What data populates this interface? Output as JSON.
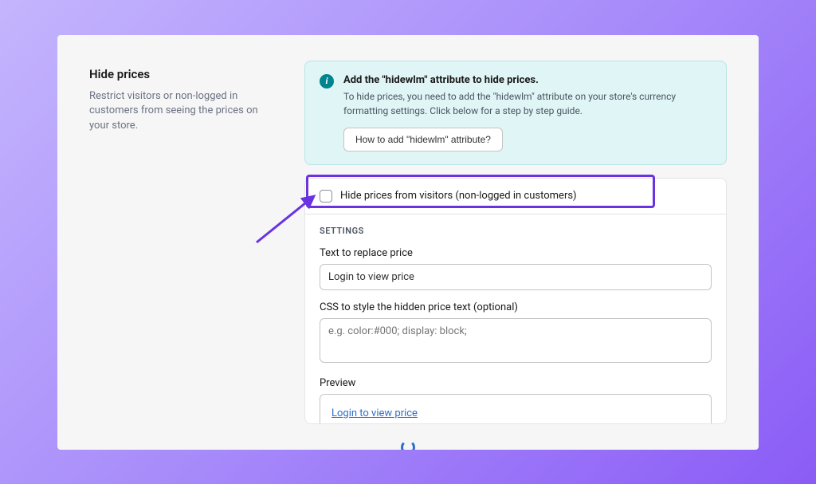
{
  "left": {
    "heading": "Hide prices",
    "desc": "Restrict visitors or non-logged in customers from seeing the prices on your store."
  },
  "banner": {
    "icon_glyph": "i",
    "title": "Add the \"hidewlm\" attribute to hide prices.",
    "text": "To hide prices, you need to add the \"hidewlm\" attribute on your store's currency formatting settings. Click below for a step by step guide.",
    "button": "How to add \"hidewlm\" attribute?"
  },
  "card": {
    "checkbox_label": "Hide prices from visitors (non-logged in customers)",
    "settings_header": "SETTINGS",
    "field_replace_label": "Text to replace price",
    "field_replace_value": "Login to view price",
    "field_css_label": "CSS to style the hidden price text (optional)",
    "field_css_placeholder": "e.g. color:#000; display: block;",
    "preview_label": "Preview",
    "preview_link": "Login to view price"
  }
}
